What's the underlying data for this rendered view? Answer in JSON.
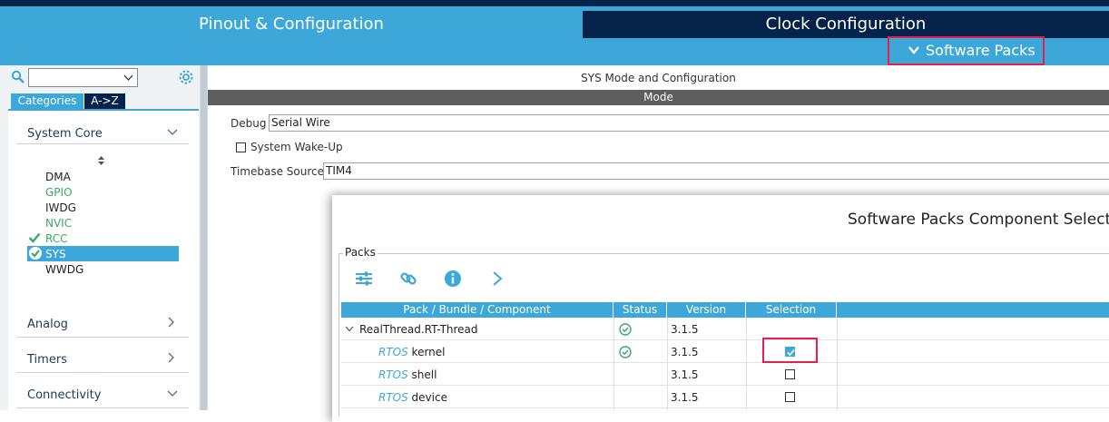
{
  "header": {
    "tab_pinout": "Pinout & Configuration",
    "tab_clock": "Clock Configuration",
    "software_packs": "Software Packs",
    "colors": {
      "primary": "#3ea7da",
      "dark": "#03234b",
      "highlight": "#e5204a"
    }
  },
  "left_panel": {
    "search_value": "",
    "tab_categories": "Categories",
    "tab_az": "A->Z",
    "system_core": {
      "title": "System Core",
      "items": [
        {
          "label": "DMA",
          "state": "normal"
        },
        {
          "label": "GPIO",
          "state": "green"
        },
        {
          "label": "IWDG",
          "state": "normal"
        },
        {
          "label": "NVIC",
          "state": "green"
        },
        {
          "label": "RCC",
          "state": "check"
        },
        {
          "label": "SYS",
          "state": "selected"
        },
        {
          "label": "WWDG",
          "state": "normal"
        }
      ]
    },
    "sections": [
      {
        "title": "Analog",
        "chevron": "chevron-right"
      },
      {
        "title": "Timers",
        "chevron": "chevron-right"
      },
      {
        "title": "Connectivity",
        "chevron": "chevron-down"
      }
    ]
  },
  "mode_panel": {
    "title": "SYS Mode and Configuration",
    "mode_bar": "Mode",
    "debug_label": "Debug",
    "debug_value": "Serial Wire",
    "wakeup_label": "System Wake-Up",
    "timebase_label": "Timebase Source",
    "timebase_value": "TIM4"
  },
  "dialog": {
    "title": "Software Packs Component Selecto",
    "packs_label": "Packs",
    "toolbar_icons": [
      "filter-icon",
      "link-icon",
      "info-icon",
      "chevron-right-icon"
    ],
    "columns": [
      "Pack / Bundle / Component",
      "Status",
      "Version",
      "Selection"
    ],
    "rows": [
      {
        "prefix": "",
        "name": "RealThread.RT-Thread",
        "status": "ok",
        "version": "3.1.5",
        "selection": "none"
      },
      {
        "prefix": "RTOS",
        "name": " kernel",
        "status": "ok",
        "version": "3.1.5",
        "selection": "checked"
      },
      {
        "prefix": "RTOS",
        "name": " shell",
        "status": "",
        "version": "3.1.5",
        "selection": "unchecked"
      },
      {
        "prefix": "RTOS",
        "name": " device",
        "status": "",
        "version": "3.1.5",
        "selection": "unchecked"
      }
    ]
  }
}
